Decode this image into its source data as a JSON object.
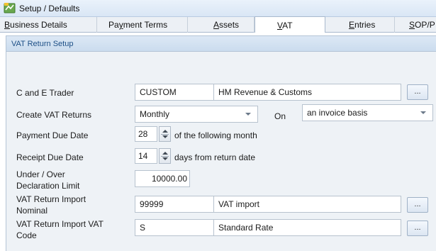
{
  "window": {
    "title": "Setup / Defaults"
  },
  "tabs": [
    {
      "label": "Business Details",
      "access_key": "B",
      "rest": "usiness Details"
    },
    {
      "label": "Payment Terms",
      "pre": "Pa",
      "access_key": "y",
      "rest": "ment Terms"
    },
    {
      "label": "Assets",
      "access_key": "A",
      "rest": "ssets"
    },
    {
      "label": "VAT",
      "access_key": "V",
      "rest": "AT",
      "active": true
    },
    {
      "label": "Entries",
      "access_key": "E",
      "rest": "ntries"
    },
    {
      "label": "SOP/P",
      "access_key": "S",
      "rest": "OP/P"
    }
  ],
  "section": {
    "title": "VAT Return Setup"
  },
  "form": {
    "c_and_e_trader": {
      "label": "C and E Trader",
      "code": "CUSTOM",
      "name": "HM Revenue & Customs",
      "button": "..."
    },
    "create_vat_returns": {
      "label": "Create VAT Returns",
      "value": "Monthly",
      "on_label": "On",
      "basis": "an invoice basis"
    },
    "payment_due_date": {
      "label": "Payment Due Date",
      "value": "28",
      "suffix": "of the following month"
    },
    "receipt_due_date": {
      "label": "Receipt Due Date",
      "value": "14",
      "suffix": "days from return date"
    },
    "declaration_limit": {
      "label_line1": "Under / Over",
      "label_line2": "Declaration Limit",
      "value": "10000.00"
    },
    "import_nominal": {
      "label_line1": "VAT Return Import",
      "label_line2": "Nominal",
      "code": "99999",
      "name": "VAT import",
      "button": "..."
    },
    "import_vat_code": {
      "label_line1": "VAT Return Import VAT",
      "label_line2": "Code",
      "code": "S",
      "name": "Standard Rate",
      "button": "..."
    }
  },
  "colors": {
    "panel_bg": "#eef2f6",
    "header_text": "#1d4f86",
    "field_border": "#b7c2ce"
  }
}
